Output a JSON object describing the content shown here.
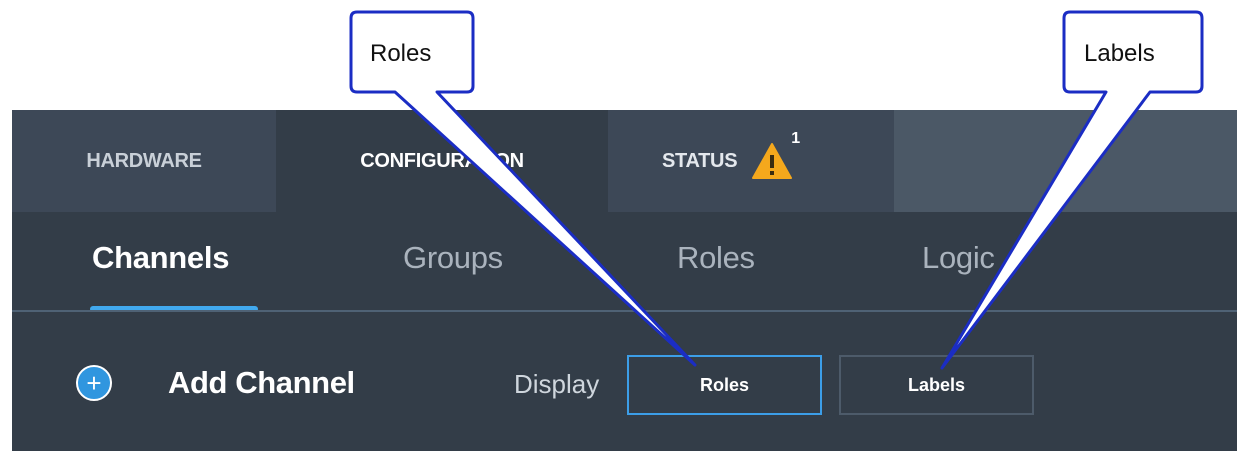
{
  "top_tabs": [
    {
      "label": "HARDWARE"
    },
    {
      "label": "CONFIGURATION"
    },
    {
      "label": "STATUS",
      "warning_count": "1"
    }
  ],
  "sub_tabs": [
    {
      "label": "Channels",
      "active": true
    },
    {
      "label": "Groups"
    },
    {
      "label": "Roles"
    },
    {
      "label": "Logic"
    }
  ],
  "toolbar": {
    "add_label": "Add Channel",
    "display_label": "Display",
    "roles_button": "Roles",
    "labels_button": "Labels"
  },
  "callouts": [
    {
      "text": "Roles"
    },
    {
      "text": "Labels"
    }
  ],
  "colors": {
    "accent": "#41a9ee",
    "warning": "#f5a81c",
    "panel": "#333d48"
  }
}
